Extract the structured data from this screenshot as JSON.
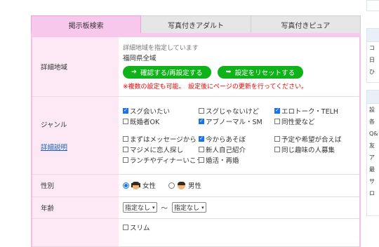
{
  "tabs": [
    {
      "label": "掲示板検索",
      "active": true
    },
    {
      "label": "写真付きアダルト",
      "active": false
    },
    {
      "label": "写真付きピュア",
      "active": false
    }
  ],
  "area": {
    "label": "詳細地域",
    "note": "詳細地域を指定しています",
    "value": "福岡県全域",
    "confirm_button": "確認する/再設定する",
    "reset_button": "設定をリセットする",
    "warning": "※複数の設定も可能。　設定後にページの更新を行ってください。"
  },
  "genre": {
    "label": "ジャンル",
    "detail_link": "詳細説明",
    "options_group1": [
      {
        "label": "スグ会いたい",
        "checked": true
      },
      {
        "label": "スグじゃないけど",
        "checked": false
      },
      {
        "label": "エロトーク・TELH",
        "checked": true
      },
      {
        "label": "既婚者OK",
        "checked": false
      },
      {
        "label": "アブノーマル・SM",
        "checked": true
      },
      {
        "label": "同性愛など",
        "checked": false
      }
    ],
    "options_group2": [
      {
        "label": "まずはメッセージから",
        "checked": false
      },
      {
        "label": "今からあそぼ",
        "checked": true
      },
      {
        "label": "予定や希望が合えば",
        "checked": false
      },
      {
        "label": "マジメに恋人探し",
        "checked": false
      },
      {
        "label": "新人自己紹介",
        "checked": false
      },
      {
        "label": "同じ趣味の人募集",
        "checked": false
      },
      {
        "label": "ランチやディナーいこう",
        "checked": false
      },
      {
        "label": "婚活・再婚",
        "checked": false
      }
    ]
  },
  "gender": {
    "label": "性別",
    "options": [
      {
        "label": "女性",
        "selected": true,
        "icon": "female-face-icon"
      },
      {
        "label": "男性",
        "selected": false,
        "icon": "male-face-icon"
      }
    ]
  },
  "age": {
    "label": "年齢",
    "from": "指定なし",
    "separator": "〜",
    "to": "指定なし"
  },
  "body": {
    "first_option": "スリム"
  },
  "sidebar": {
    "section1": [
      "コ",
      "日",
      "ひ"
    ],
    "section2": [
      "設",
      "各",
      "Q&",
      "友",
      "ア",
      "最",
      "サ",
      "ロ"
    ]
  },
  "colors": {
    "tab_active": "#f8c8ec",
    "label_bg": "#fde9f5",
    "button_green": "#10b21a",
    "warning_red": "#ee0000",
    "checkbox_blue": "#1a73e8"
  }
}
